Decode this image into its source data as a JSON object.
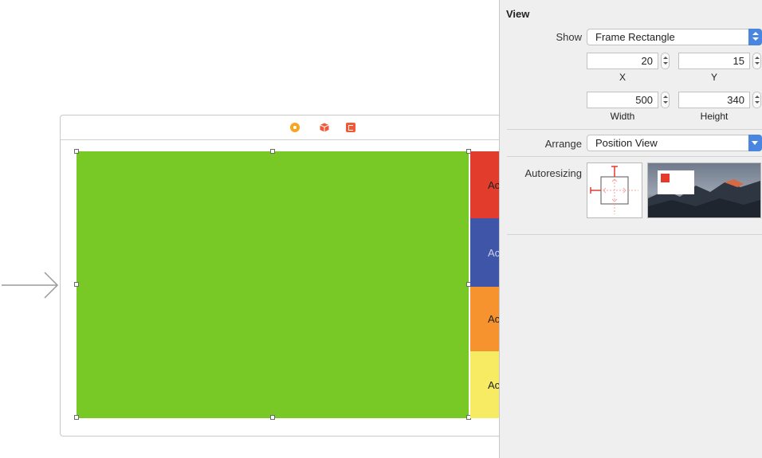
{
  "inspector": {
    "section_title": "View",
    "show": {
      "label": "Show",
      "value": "Frame Rectangle",
      "icon": "up-down-arrows-icon"
    },
    "x": {
      "value": "20",
      "caption": "X"
    },
    "y": {
      "value": "15",
      "caption": "Y"
    },
    "width": {
      "value": "500",
      "caption": "Width"
    },
    "height": {
      "value": "340",
      "caption": "Height"
    },
    "arrange": {
      "label": "Arrange",
      "value": "Position View",
      "icon": "chevron-down-icon"
    },
    "autoresizing": {
      "label": "Autoresizing"
    }
  },
  "canvas": {
    "side_buttons": [
      {
        "label": "Ac",
        "color": "#e23c2c"
      },
      {
        "label": "Ac",
        "color": "#3f55a8"
      },
      {
        "label": "Ac",
        "color": "#f7932f"
      },
      {
        "label": "Ac",
        "color": "#f6eb62"
      }
    ],
    "main_view_color": "#78c826",
    "dock_icons": [
      "view-controller-icon",
      "first-responder-icon",
      "exit-icon"
    ]
  }
}
